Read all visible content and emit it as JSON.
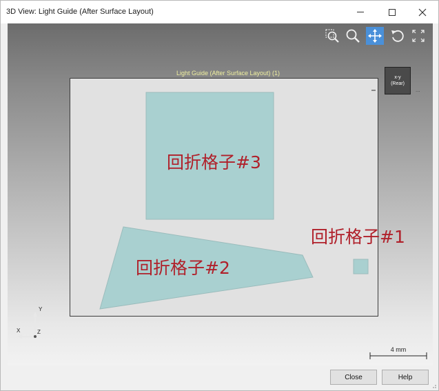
{
  "window": {
    "title": "3D View: Light Guide (After Surface Layout)"
  },
  "toolbar": {
    "icons": [
      "zoom-window-icon",
      "zoom-icon",
      "pan-icon",
      "rotate-icon",
      "fit-icon"
    ],
    "active": "pan-icon"
  },
  "viewport": {
    "view_title": "Light Guide (After Surface Layout) (1)",
    "orientation_line1": "x-y",
    "orientation_line2": "(Rear)",
    "orientation_more": "...",
    "labels": {
      "grid3": "回折格子#3",
      "grid2": "回折格子#2",
      "grid1": "回折格子#1"
    },
    "axes": {
      "y": "Y",
      "x": "X",
      "z": "Z"
    },
    "scale_label": "4 mm",
    "shape_fill": "#a9d0d0",
    "label_color": "#b0202a"
  },
  "footer": {
    "close_label": "Close",
    "help_label": "Help"
  }
}
